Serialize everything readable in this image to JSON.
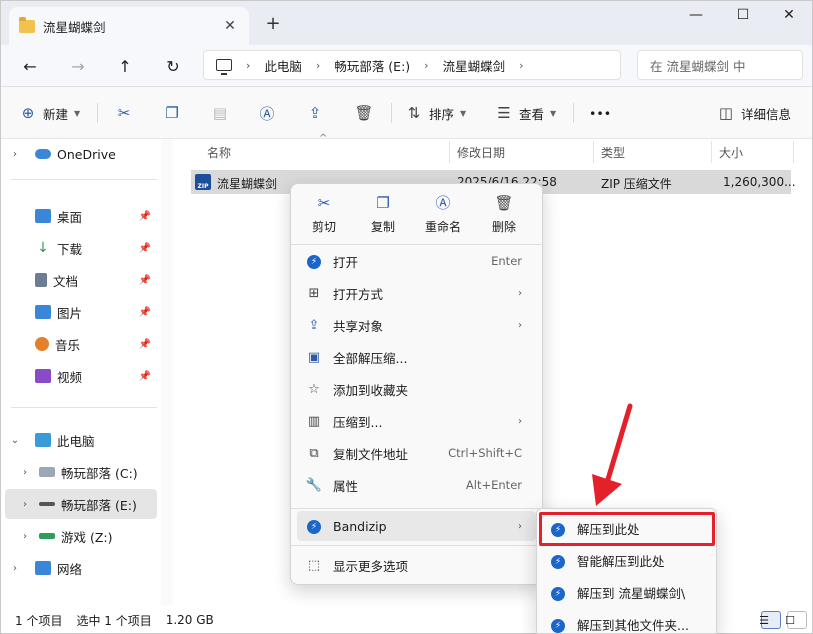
{
  "tab": {
    "title": "流星蝴蝶剑",
    "close": "✕",
    "new": "+"
  },
  "window_controls": {
    "minimize": "—",
    "maximize": "☐",
    "close": "✕"
  },
  "nav": {
    "breadcrumbs": [
      "此电脑",
      "畅玩部落 (E:)",
      "流星蝴蝶剑"
    ],
    "sep": "›",
    "search_placeholder": "在 流星蝴蝶剑 中"
  },
  "toolbar": {
    "new": "新建",
    "sort": "排序",
    "view": "查看",
    "more": "•••",
    "details": "详细信息"
  },
  "sidebar": {
    "onedrive": "OneDrive",
    "quick": [
      {
        "label": "桌面",
        "color": "#3a86d8"
      },
      {
        "label": "下载",
        "color": "#2e9c5a"
      },
      {
        "label": "文档",
        "color": "#6b7d93"
      },
      {
        "label": "图片",
        "color": "#3a86d8"
      },
      {
        "label": "音乐",
        "color": "#e57f2c"
      },
      {
        "label": "视频",
        "color": "#8a4bc8"
      }
    ],
    "pc": "此电脑",
    "drives": [
      "畅玩部落 (C:)",
      "畅玩部落 (E:)",
      "游戏 (Z:)"
    ],
    "network": "网络"
  },
  "columns": {
    "name": "名称",
    "modified": "修改日期",
    "type": "类型",
    "size": "大小"
  },
  "file": {
    "name": "流星蝴蝶剑",
    "modified": "2025/6/16 22:58",
    "type": "ZIP 压缩文件",
    "size": "1,260,300...",
    "icon_text": "ZIP"
  },
  "context_menu": {
    "quick": {
      "cut": "剪切",
      "copy": "复制",
      "rename": "重命名",
      "delete": "删除"
    },
    "items": {
      "open": "打开",
      "open_key": "Enter",
      "open_with": "打开方式",
      "share": "共享对象",
      "extract_all": "全部解压缩...",
      "favorite": "添加到收藏夹",
      "compress": "压缩到...",
      "copy_path": "复制文件地址",
      "copy_path_key": "Ctrl+Shift+C",
      "properties": "属性",
      "properties_key": "Alt+Enter",
      "bandizip": "Bandizip",
      "more_options": "显示更多选项"
    }
  },
  "submenu": {
    "extract_here": "解压到此处",
    "smart_extract": "智能解压到此处",
    "extract_to_folder": "解压到 流星蝴蝶剑\\",
    "extract_other": "解压到其他文件夹..."
  },
  "status": {
    "count": "1 个项目",
    "selected": "选中 1 个项目",
    "size": "1.20 GB"
  },
  "colors": {
    "accent": "#2d5ba8",
    "highlight": "#e4202a",
    "bandizip": "#1b66c9"
  }
}
